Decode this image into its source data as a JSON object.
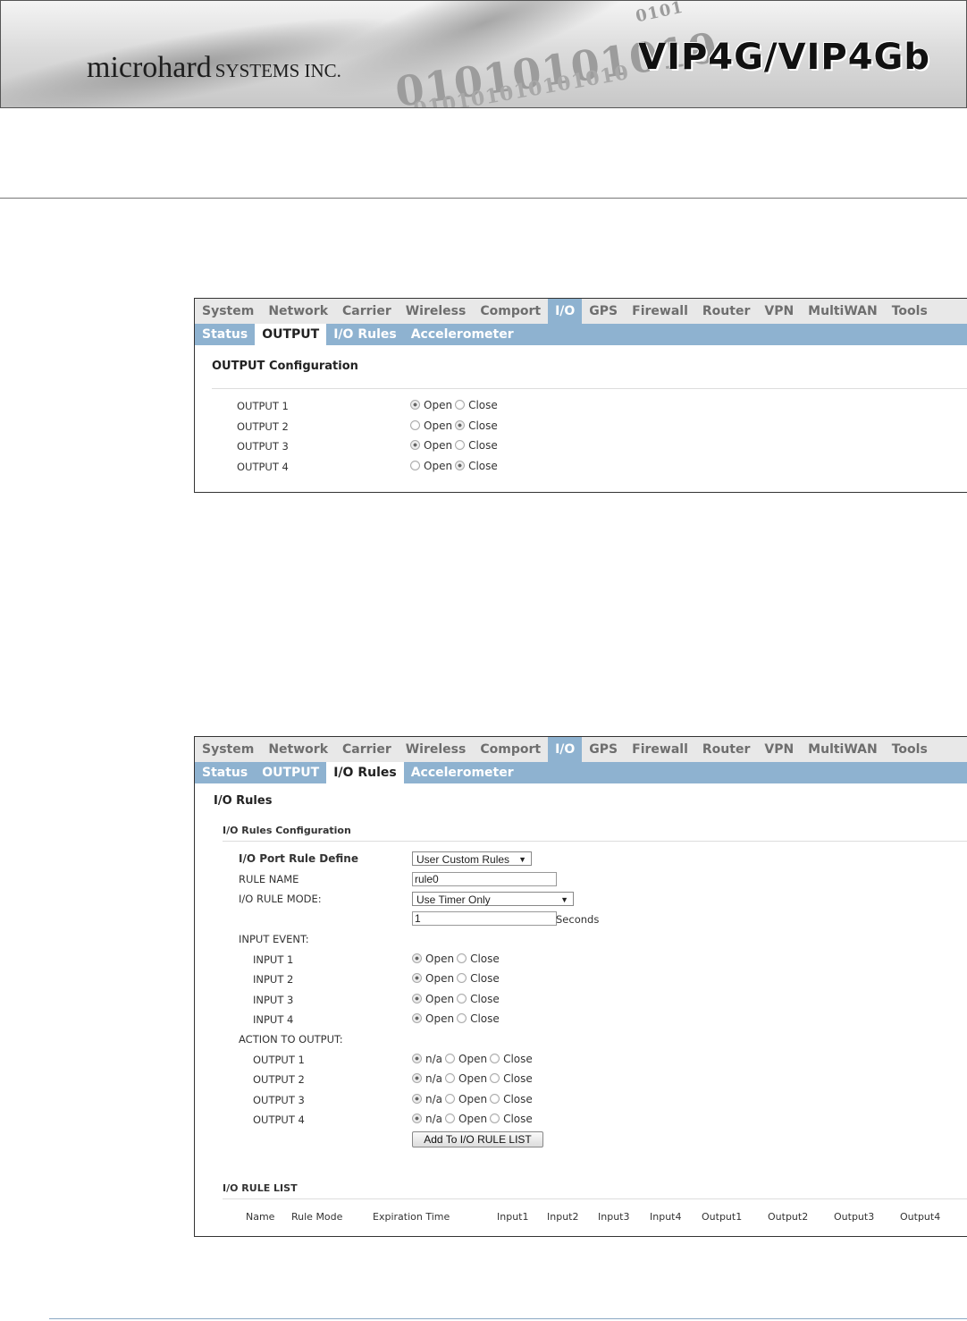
{
  "banner": {
    "company_main": "microhard",
    "company_sub": "SYSTEMS INC.",
    "product": "VIP4G/VIP4Gb",
    "binary_1": "01010101010",
    "binary_2": "010101010101010",
    "binary_3": "0101"
  },
  "nav": {
    "menu": [
      "System",
      "Network",
      "Carrier",
      "Wireless",
      "Comport",
      "I/O",
      "GPS",
      "Firewall",
      "Router",
      "VPN",
      "MultiWAN",
      "Tools"
    ],
    "active_menu": "I/O",
    "submenu": [
      "Status",
      "OUTPUT",
      "I/O Rules",
      "Accelerometer"
    ]
  },
  "output_panel": {
    "title": "OUTPUT Configuration",
    "rows": [
      {
        "label": "OUTPUT 1",
        "selected": "Open"
      },
      {
        "label": "OUTPUT 2",
        "selected": "Close"
      },
      {
        "label": "OUTPUT 3",
        "selected": "Open"
      },
      {
        "label": "OUTPUT 4",
        "selected": "Close"
      }
    ],
    "opt_open": "Open",
    "opt_close": "Close"
  },
  "rules_panel": {
    "title": "I/O Rules",
    "config_title": "I/O Rules Configuration",
    "port_rule_label": "I/O Port Rule Define",
    "port_rule_value": "User Custom Rules",
    "rule_name_label": "RULE NAME",
    "rule_name_value": "rule0",
    "rule_mode_label": "I/O RULE MODE:",
    "rule_mode_value": "Use Timer Only",
    "timer_value": "1",
    "timer_unit": "Seconds",
    "input_event_label": "INPUT EVENT:",
    "inputs": [
      {
        "label": "INPUT 1",
        "selected": "Open"
      },
      {
        "label": "INPUT 2",
        "selected": "Open"
      },
      {
        "label": "INPUT 3",
        "selected": "Open"
      },
      {
        "label": "INPUT 4",
        "selected": "Open"
      }
    ],
    "action_label": "ACTION TO OUTPUT:",
    "outputs": [
      {
        "label": "OUTPUT 1",
        "selected": "n/a"
      },
      {
        "label": "OUTPUT 2",
        "selected": "n/a"
      },
      {
        "label": "OUTPUT 3",
        "selected": "n/a"
      },
      {
        "label": "OUTPUT 4",
        "selected": "n/a"
      }
    ],
    "opt_na": "n/a",
    "opt_open": "Open",
    "opt_close": "Close",
    "add_button": "Add To I/O RULE LIST",
    "list_title": "I/O RULE LIST",
    "columns": [
      "Name",
      "Rule Mode",
      "Expiration Time",
      "Input1",
      "Input2",
      "Input3",
      "Input4",
      "Output1",
      "Output2",
      "Output3",
      "Output4"
    ]
  }
}
